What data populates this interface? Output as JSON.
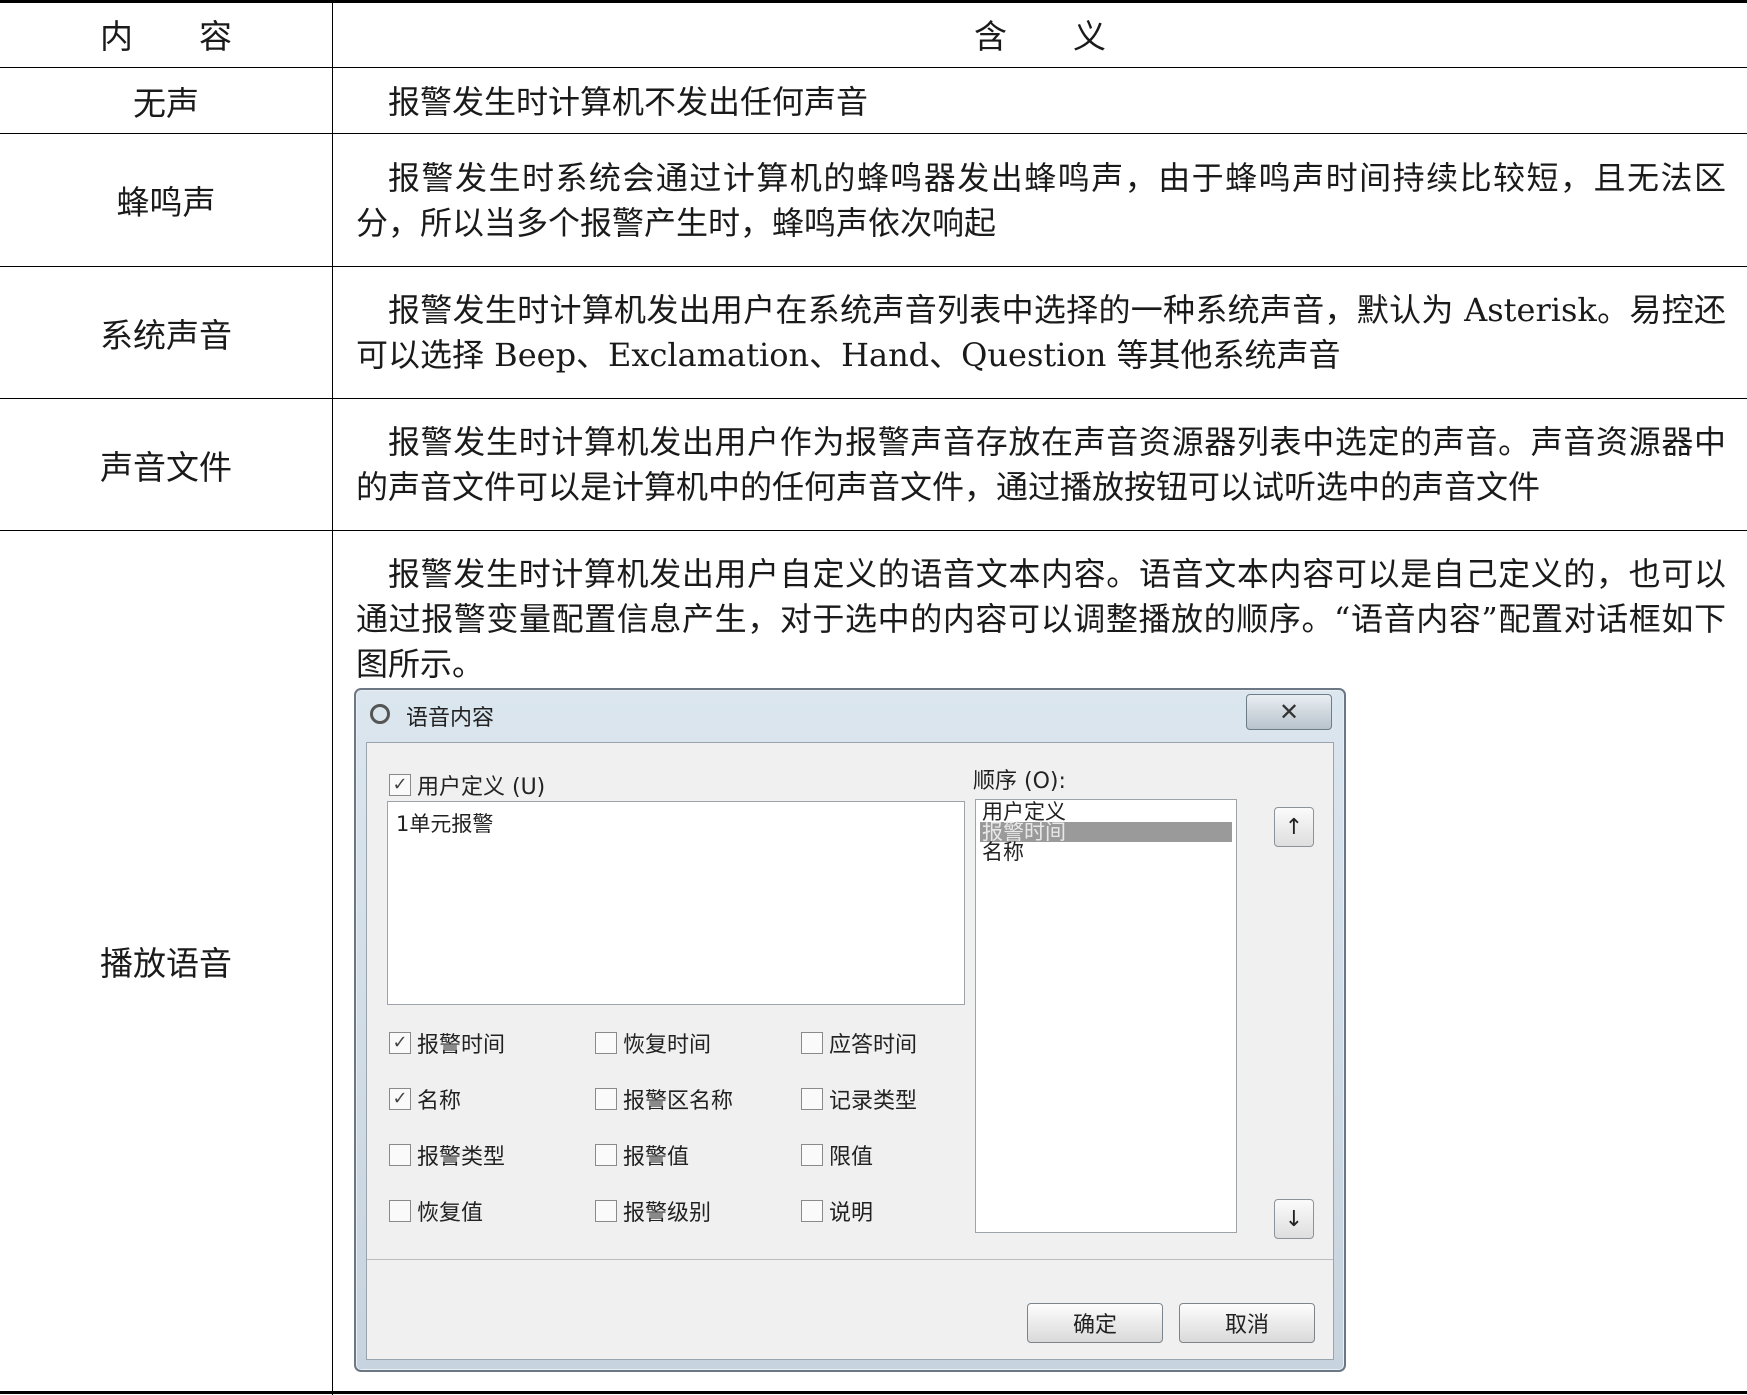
{
  "table": {
    "header": {
      "key": "内　　容",
      "value": "含　　义"
    },
    "rows": [
      {
        "key": "无声",
        "value": "报警发生时计算机不发出任何声音"
      },
      {
        "key": "蜂鸣声",
        "value": "报警发生时系统会通过计算机的蜂鸣器发出蜂鸣声，由于蜂鸣声时间持续比较短，且无法区分，所以当多个报警产生时，蜂鸣声依次响起"
      },
      {
        "key": "系统声音",
        "value": "报警发生时计算机发出用户在系统声音列表中选择的一种系统声音，默认为 Asterisk。易控还可以选择 Beep、Exclamation、Hand、Question 等其他系统声音"
      },
      {
        "key": "声音文件",
        "value": "报警发生时计算机发出用户作为报警声音存放在声音资源器列表中选定的声音。声音资源器中的声音文件可以是计算机中的任何声音文件，通过播放按钮可以试听选中的声音文件"
      },
      {
        "key": "播放语音",
        "value": "报警发生时计算机发出用户自定义的语音文本内容。语音文本内容可以是自己定义的，也可以通过报警变量配置信息产生，对于选中的内容可以调整播放的顺序。“语音内容”配置对话框如下图所示。"
      }
    ]
  },
  "dialog": {
    "title": "语音内容",
    "close": "✕",
    "user_define": {
      "label": "用户定义 (U)",
      "checked": true
    },
    "text_value": "1单元报警",
    "order_label": "顺序 (O):",
    "order_items": [
      "用户定义",
      "报警时间",
      "名称"
    ],
    "selected_order": 1,
    "up": "↑",
    "down": "↓",
    "check_mark": "✓",
    "options": [
      {
        "label": "报警时间",
        "checked": true
      },
      {
        "label": "恢复时间",
        "checked": false
      },
      {
        "label": "应答时间",
        "checked": false
      },
      {
        "label": "名称",
        "checked": true
      },
      {
        "label": "报警区名称",
        "checked": false
      },
      {
        "label": "记录类型",
        "checked": false
      },
      {
        "label": "报警类型",
        "checked": false
      },
      {
        "label": "报警值",
        "checked": false
      },
      {
        "label": "限值",
        "checked": false
      },
      {
        "label": "恢复值",
        "checked": false
      },
      {
        "label": "报警级别",
        "checked": false
      },
      {
        "label": "说明",
        "checked": false
      }
    ],
    "ok": "确定",
    "cancel": "取消"
  }
}
